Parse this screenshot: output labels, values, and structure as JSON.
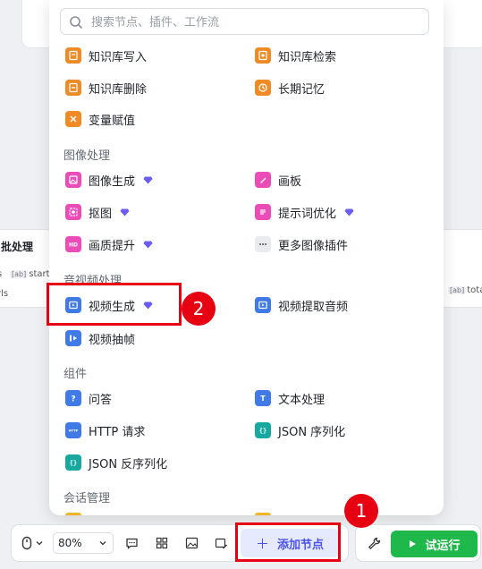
{
  "canvas": {
    "left_node": {
      "title": "批处理",
      "chip_a": "s",
      "chip_b": "start",
      "chip_c": "rls"
    },
    "right_node": {
      "chip": "total_"
    }
  },
  "search": {
    "placeholder": "搜索节点、插件、工作流"
  },
  "groups": {
    "top": [
      {
        "label": "知识库写入",
        "icon": "knowledge-write-icon"
      },
      {
        "label": "知识库检索",
        "icon": "knowledge-search-icon"
      },
      {
        "label": "知识库删除",
        "icon": "knowledge-delete-icon"
      },
      {
        "label": "长期记忆",
        "icon": "long-term-memory-icon"
      },
      {
        "label": "变量赋值",
        "icon": "variable-assign-icon"
      }
    ],
    "image": {
      "title": "图像处理",
      "items": [
        {
          "label": "图像生成",
          "icon": "image-generate-icon",
          "premium": true
        },
        {
          "label": "画板",
          "icon": "canvas-board-icon",
          "premium": false
        },
        {
          "label": "抠图",
          "icon": "cutout-icon",
          "premium": true
        },
        {
          "label": "提示词优化",
          "icon": "prompt-optimize-icon",
          "premium": true
        },
        {
          "label": "画质提升",
          "icon": "hd-enhance-icon",
          "premium": true
        },
        {
          "label": "更多图像插件",
          "icon": "more-icon",
          "premium": false
        }
      ]
    },
    "video": {
      "title": "音视频处理",
      "items": [
        {
          "label": "视频生成",
          "icon": "video-generate-icon",
          "premium": true
        },
        {
          "label": "视频提取音频",
          "icon": "video-audio-extract-icon",
          "premium": false
        },
        {
          "label": "视频抽帧",
          "icon": "video-frame-icon",
          "premium": false
        }
      ]
    },
    "components": {
      "title": "组件",
      "items": [
        {
          "label": "问答",
          "icon": "question-answer-icon"
        },
        {
          "label": "文本处理",
          "icon": "text-process-icon"
        },
        {
          "label": "HTTP 请求",
          "icon": "http-request-icon"
        },
        {
          "label": "JSON 序列化",
          "icon": "json-serialize-icon"
        },
        {
          "label": "JSON 反序列化",
          "icon": "json-deserialize-icon"
        }
      ]
    },
    "session": {
      "title": "会话管理"
    }
  },
  "toolbar": {
    "zoom": "80%",
    "add_node": "添加节点",
    "run": "试运行"
  },
  "annotations": {
    "badge_1": "1",
    "badge_2": "2"
  },
  "colors": {
    "accent": "#4d53e8",
    "run_green": "#1fb84a",
    "highlight_red": "#e60012",
    "orange_icon": "#f08a24",
    "pink_icon": "#ec4cb8",
    "blue_icon": "#3f7ae6",
    "teal_icon": "#17a9a0"
  }
}
